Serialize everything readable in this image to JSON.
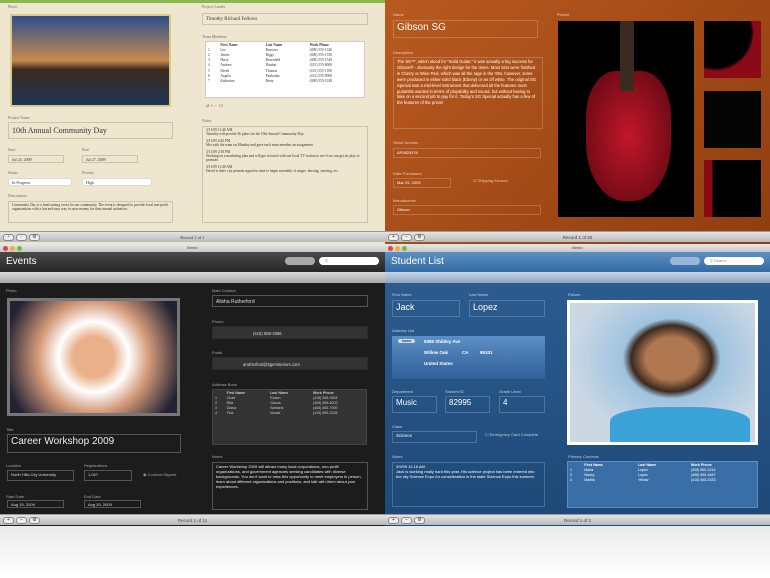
{
  "project": {
    "photo_label": "Photo",
    "name_label": "Project Name",
    "name": "10th Annual Community Day",
    "start_label": "Start",
    "start": "Jul 24, 2009",
    "end_label": "End",
    "end": "Jul 27, 2009",
    "status_label": "Status",
    "status": "In Progress",
    "priority_label": "Priority",
    "priority": "High",
    "desc_label": "Description",
    "desc": "Community Day is a fund raising event for our community. The event is designed to provide local non-profit organizations with a fun and easy way to raise money for their annual initiatives.",
    "lead_label": "Project Leader",
    "lead": "Timothy Richard Fellows",
    "team_label": "Team Members",
    "team_headers": [
      "First Name",
      "Last Name",
      "Work Phone"
    ],
    "team": [
      [
        "1",
        "Lee",
        "Burrows",
        "(408) 555-1346"
      ],
      [
        "2",
        "Jennie",
        "Riggs",
        "(408) 555-1358"
      ],
      [
        "3",
        "Harry",
        "Rosenfeld",
        "(408) 555-1349"
      ],
      [
        "4",
        "Andrew",
        "Dunbar",
        "(415) 555-8000"
      ],
      [
        "5",
        "Derek",
        "Thomas",
        "(415) 555-1180"
      ],
      [
        "6",
        "Angela",
        "Fairbanks",
        "(415) 555-9000"
      ],
      [
        "7",
        "Katherine",
        "Berry",
        "(408) 555-1248"
      ]
    ],
    "notes_label": "Notes",
    "notes": [
      "3/11/09 11:46 AM",
      "Timothy will provide 5k plans for the 10th Annual Community Day.",
      "3/11/09 4:45 PM",
      "Met with the team on Monday and gave each team member an assignment.",
      "3/11/09 2:30 PM",
      "Working on a marketing plan and will get in touch with our local TV station to see if we can get air play to promote.",
      "3/11/09 11:40 AM",
      "David is there city permits signed in time to begin assembly of stages, fencing, catering, etc."
    ],
    "record": "Record 1 of 1"
  },
  "guitar": {
    "name_label": "Name",
    "name": "Gibson SG",
    "desc_label": "Description",
    "desc": "The SG™, which stood for \"Solid Guitar,\" it was actually a big success for Gibson® - obviously the right design for the times. Most SGs were finished in Cherry or Wine Red, which was all the rage in the '60s, however, some were produced in either solid black (Ebony) or an off white. The original SG Special was a mid-level instrument that delivered all the features most guitarists wanted in terms of playability and sound, but without having to take on a second job to pay for it. Today's SG Special actually has a few of the features of the pricier",
    "serial_label": "Serial Number",
    "serial": "AF0820376",
    "date_label": "Date Purchased",
    "date": "Mar 25, 2009",
    "insured": "Shipping Insured",
    "mfr_label": "Manufacturer",
    "mfr": "Gibson",
    "picture_label": "Picture",
    "record": "Record 1 of 20"
  },
  "events": {
    "window_title": "Bento",
    "title": "Events",
    "photo_label": "Photo",
    "title_label": "Title",
    "event_title": "Career Workshop 2009",
    "location_label": "Location",
    "location": "North Hills City University",
    "reg_label": "Registrations",
    "reg": "1,047",
    "contract": "Contract Signed",
    "start_label": "Start Date",
    "start": "Aug 15, 2009",
    "end_label": "End Date",
    "end": "Aug 20, 2009",
    "contact_label": "Main Contact",
    "contact": "Alisha Rutherford",
    "phone_label": "Phone",
    "phone": "(415) 555-2356",
    "email_label": "Email",
    "email": "arutherford@tigerinteriors.com",
    "ab_label": "Address Book",
    "ab_headers": [
      "First Name",
      "Last Name",
      "Work Phone"
    ],
    "ab": [
      [
        "1",
        "Chad",
        "Rosen",
        "(415) 555-9904"
      ],
      [
        "2",
        "Rita",
        "Garcia",
        "(408) 555-6203"
      ],
      [
        "3",
        "Diana",
        "Santana",
        "(408) 555-7900"
      ],
      [
        "4",
        "Tina",
        "Novak",
        "(415) 555-2205"
      ]
    ],
    "notes_label": "Notes",
    "notes": "Career Workshop 2009 will attract many local corporations, non-profit organizations, and government agencies seeking candidates with diverse backgrounds. You don't want to miss this opportunity to meet employers in person, learn about different organizations and positions, and talk with them about your experiences.",
    "record": "Record 1 of 11"
  },
  "students": {
    "window_title": "Bento",
    "title": "Student List",
    "search_placeholder": "Search",
    "first_label": "First Name",
    "first": "Jack",
    "last_label": "Last Name",
    "last": "Lopez",
    "addr_label": "Address List",
    "addr_tag": "home",
    "street": "5385 Shibley Ave",
    "city": "Willow Oak",
    "state": "CA",
    "zip": "95101",
    "country": "United States",
    "dept_label": "Department",
    "dept": "Music",
    "id_label": "Student ID",
    "id": "82995",
    "grade_label": "Grade Level",
    "grade": "4",
    "class_label": "Class",
    "class": "Science",
    "emergency": "Emergency Card Complete",
    "notes_label": "Notes",
    "notes_date": "3/9/09 11:16 AM",
    "notes": "Jack is working really hard this year. His science project has been entered into the city Science Expo for consideration in the state Science Expo this summer.",
    "picture_label": "Picture",
    "pc_label": "Primary Contacts",
    "pc_headers": [
      "First Name",
      "Last Name",
      "Work Phone"
    ],
    "pc": [
      [
        "1",
        "Maria",
        "Lopez",
        "(408) 555-3214"
      ],
      [
        "2",
        "Nancy",
        "Lopez",
        "(408) 555-4467"
      ],
      [
        "3",
        "Marilia",
        "Yellow",
        "(415) 555-3333"
      ]
    ],
    "record": "Record 1 of 2"
  }
}
